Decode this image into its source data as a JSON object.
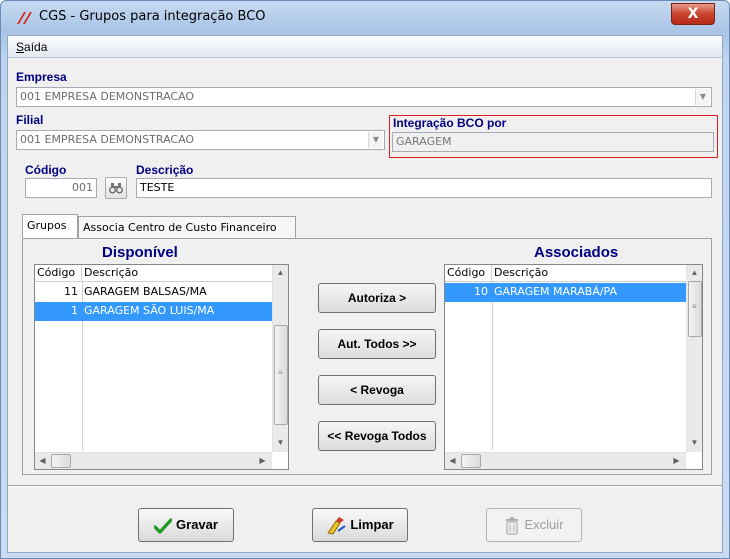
{
  "window": {
    "title": "CGS - Grupos para integração BCO",
    "close_label": "X"
  },
  "menu": {
    "items": [
      {
        "label": "Saída"
      }
    ]
  },
  "form": {
    "empresa_label": "Empresa",
    "empresa_value": "001 EMPRESA DEMONSTRACAO",
    "filial_label": "Filial",
    "filial_value": "001 EMPRESA DEMONSTRACAO",
    "integracao_label": "Integração BCO por",
    "integracao_value": "GARAGEM",
    "codigo_label": "Código",
    "codigo_value": "001",
    "descricao_label": "Descrição",
    "descricao_value": "TESTE"
  },
  "tabs": [
    {
      "label": "Grupos",
      "active": true
    },
    {
      "label": "Associa Centro de Custo Financeiro",
      "active": false
    }
  ],
  "disponivel": {
    "title": "Disponível",
    "columns": [
      "Código",
      "Descrição"
    ],
    "rows": [
      {
        "code": "11",
        "desc": "GARAGEM BALSAS/MA",
        "selected": false
      },
      {
        "code": "1",
        "desc": "GARAGEM SÃO LUIS/MA",
        "selected": true
      }
    ]
  },
  "associados": {
    "title": "Associados",
    "columns": [
      "Código",
      "Descrição"
    ],
    "rows": [
      {
        "code": "10",
        "desc": "GARAGEM MARABÁ/PA",
        "selected": true
      }
    ]
  },
  "transfer_buttons": {
    "autoriza": "Autoriza >",
    "aut_todos": "Aut. Todos >>",
    "revoga": "< Revoga",
    "revoga_todos": "<< Revoga Todos"
  },
  "actions": {
    "gravar": "Gravar",
    "limpar": "Limpar",
    "excluir": "Excluir"
  },
  "colors": {
    "label_blue": "#000080",
    "selection": "#3399ff",
    "highlight_border": "#e02020"
  },
  "icons": [
    "app-logo-icon",
    "binoculars-icon",
    "checkmark-icon",
    "eraser-icon",
    "trash-icon"
  ]
}
